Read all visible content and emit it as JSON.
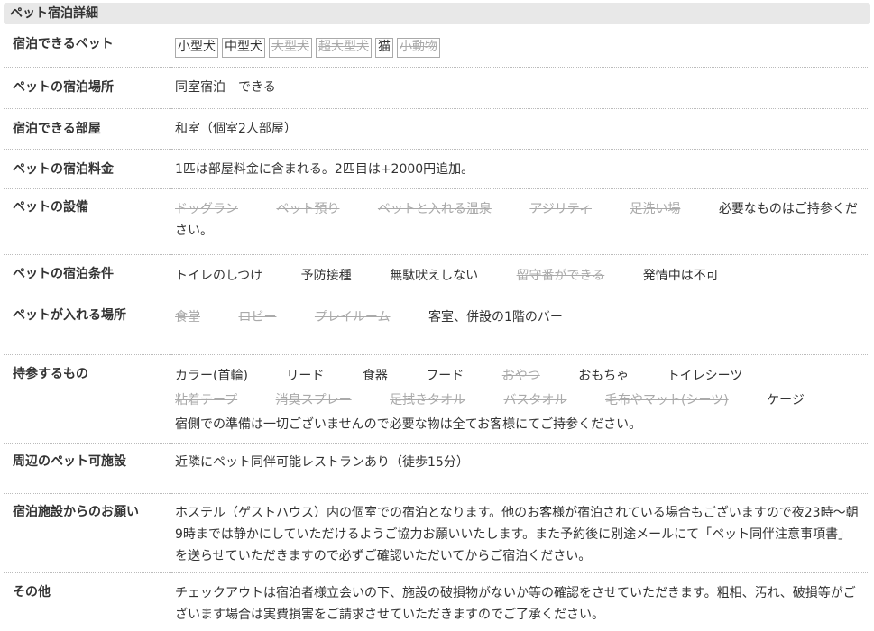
{
  "title": "ペット宿泊詳細",
  "rows": {
    "pets": {
      "label": "宿泊できるペット",
      "tags": [
        {
          "text": "小型犬",
          "on": true
        },
        {
          "text": "中型犬",
          "on": true
        },
        {
          "text": "大型犬",
          "on": false
        },
        {
          "text": "超大型犬",
          "on": false
        },
        {
          "text": "猫",
          "on": true
        },
        {
          "text": "小動物",
          "on": false
        }
      ]
    },
    "place": {
      "label": "ペットの宿泊場所",
      "value": "同室宿泊　できる"
    },
    "room": {
      "label": "宿泊できる部屋",
      "value": "和室（個室2人部屋）"
    },
    "fee": {
      "label": "ペットの宿泊料金",
      "value": "1匹は部屋料金に含まれる。2匹目は+2000円追加。"
    },
    "facility": {
      "label": "ペットの設備",
      "items": [
        {
          "text": "ドッグラン",
          "on": false
        },
        {
          "text": "ペット預り",
          "on": false
        },
        {
          "text": "ペットと入れる温泉",
          "on": false
        },
        {
          "text": "アジリティ",
          "on": false
        },
        {
          "text": "足洗い場",
          "on": false
        }
      ],
      "note": "必要なものはご持参ください。"
    },
    "conditions": {
      "label": "ペットの宿泊条件",
      "items": [
        {
          "text": "トイレのしつけ",
          "on": true
        },
        {
          "text": "予防接種",
          "on": true
        },
        {
          "text": "無駄吠えしない",
          "on": true
        },
        {
          "text": "留守番ができる",
          "on": false
        },
        {
          "text": "発情中は不可",
          "on": true
        }
      ]
    },
    "areas": {
      "label": "ペットが入れる場所",
      "items": [
        {
          "text": "食堂",
          "on": false
        },
        {
          "text": "ロビー",
          "on": false
        },
        {
          "text": "プレイルーム",
          "on": false
        }
      ],
      "note": "客室、併設の1階のバー"
    },
    "bring": {
      "label": "持参するもの",
      "items": [
        {
          "text": "カラー(首輪)",
          "on": true
        },
        {
          "text": "リード",
          "on": true
        },
        {
          "text": "食器",
          "on": true
        },
        {
          "text": "フード",
          "on": true
        },
        {
          "text": "おやつ",
          "on": false
        },
        {
          "text": "おもちゃ",
          "on": true
        },
        {
          "text": "トイレシーツ",
          "on": true
        },
        {
          "text": "粘着テープ",
          "on": false
        },
        {
          "text": "消臭スプレー",
          "on": false
        },
        {
          "text": "足拭きタオル",
          "on": false
        },
        {
          "text": "バスタオル",
          "on": false
        },
        {
          "text": "毛布やマット(シーツ)",
          "on": false
        },
        {
          "text": "ケージ",
          "on": true
        }
      ],
      "note": "宿側での準備は一切ございませんので必要な物は全てお客様にてご持参ください。"
    },
    "nearby": {
      "label": "周辺のペット可施設",
      "value": "近隣にペット同伴可能レストランあり（徒歩15分）"
    },
    "request": {
      "label": "宿泊施設からのお願い",
      "value": "ホステル（ゲストハウス）内の個室での宿泊となります。他のお客様が宿泊されている場合もございますので夜23時～朝9時までは静かにしていただけるようご協力お願いいたします。また予約後に別途メールにて「ペット同伴注意事項書」を送らせていただきますので必ずご確認いただいてからご宿泊ください。"
    },
    "other": {
      "label": "その他",
      "value": "チェックアウトは宿泊者様立会いの下、施設の破損物がないか等の確認をさせていただきます。粗相、汚れ、破損等がございます場合は実費損害をご請求させていただきますのでご了承ください。"
    }
  }
}
